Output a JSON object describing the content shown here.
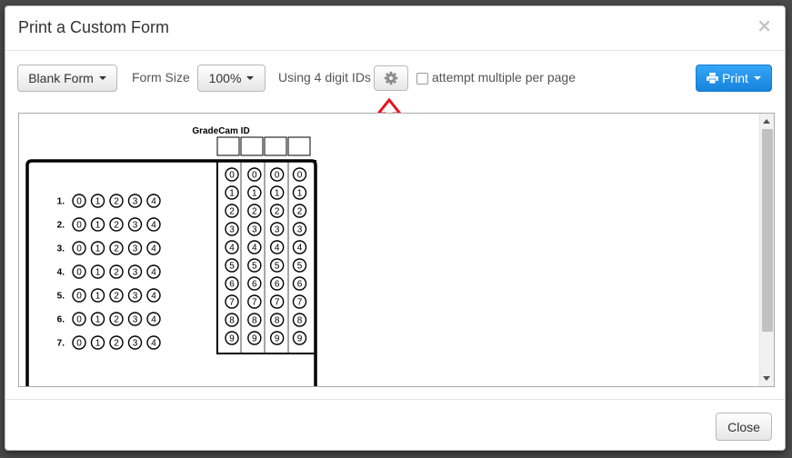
{
  "modal": {
    "title": "Print a Custom Form",
    "close_symbol": "×"
  },
  "toolbar": {
    "blank_form_label": "Blank Form",
    "form_size_label": "Form Size",
    "form_size_value": "100%",
    "digit_ids_label": "Using 4 digit IDs",
    "settings_icon": "gear-icon",
    "attempt_multiple_checked": false,
    "attempt_multiple_label": "attempt multiple per page",
    "print_label": "Print",
    "print_icon": "printer-icon",
    "primary_color": "#2a95ea"
  },
  "annotation": {
    "arrow_icon": "red-up-arrow-icon",
    "arrow_color": "#e8101b"
  },
  "form": {
    "id_header": "GradeCam ID",
    "id_digits": [
      "0",
      "1",
      "2",
      "3",
      "4",
      "5",
      "6",
      "7",
      "8",
      "9"
    ],
    "id_columns": 4,
    "questions": [
      {
        "number": "1.",
        "choices": [
          "0",
          "1",
          "2",
          "3",
          "4"
        ]
      },
      {
        "number": "2.",
        "choices": [
          "0",
          "1",
          "2",
          "3",
          "4"
        ]
      },
      {
        "number": "3.",
        "choices": [
          "0",
          "1",
          "2",
          "3",
          "4"
        ]
      },
      {
        "number": "4.",
        "choices": [
          "0",
          "1",
          "2",
          "3",
          "4"
        ]
      },
      {
        "number": "5.",
        "choices": [
          "0",
          "1",
          "2",
          "3",
          "4"
        ]
      },
      {
        "number": "6.",
        "choices": [
          "0",
          "1",
          "2",
          "3",
          "4"
        ]
      },
      {
        "number": "7.",
        "choices": [
          "0",
          "1",
          "2",
          "3",
          "4"
        ]
      }
    ]
  },
  "footer": {
    "close_label": "Close"
  }
}
